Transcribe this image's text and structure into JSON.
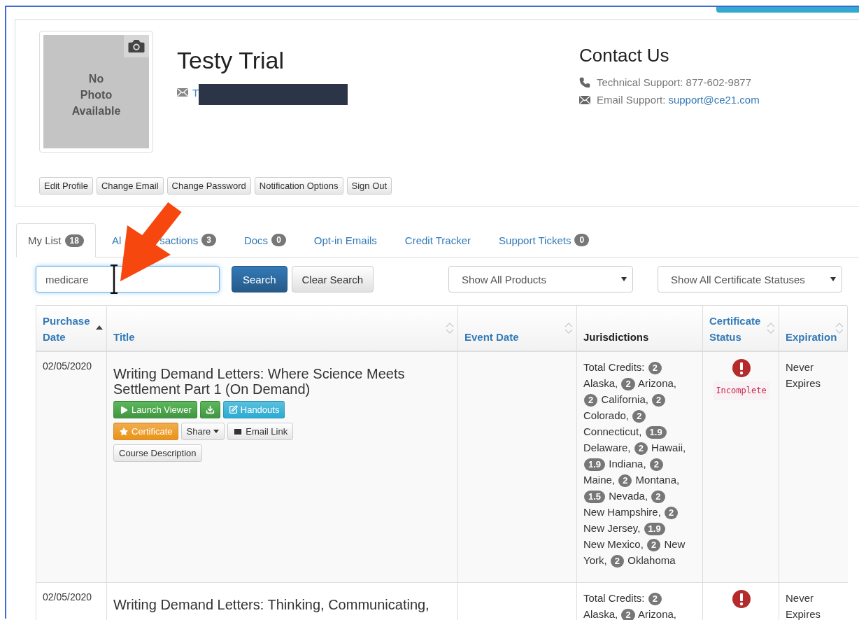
{
  "profile": {
    "photo_lines": [
      "No",
      "Photo",
      "Available"
    ],
    "name": "Testy Trial",
    "email": "T",
    "buttons": [
      "Edit Profile",
      "Change Email",
      "Change Password",
      "Notification Options",
      "Sign Out"
    ]
  },
  "contact": {
    "title": "Contact Us",
    "phone": "Technical Support: 877-602-9877",
    "email_label": "Email Support:",
    "email": "support@ce21.com"
  },
  "tabs": [
    {
      "label_parts": [
        "My List"
      ],
      "count": "18",
      "selected": true
    },
    {
      "label_parts": [
        "Al",
        "sactions"
      ],
      "count": "3",
      "selected": false
    },
    {
      "label_parts": [
        "Docs"
      ],
      "count": "0",
      "selected": false
    },
    {
      "label_parts": [
        "Opt-in Emails"
      ],
      "selected": false
    },
    {
      "label_parts": [
        "Credit Tracker"
      ],
      "selected": false
    },
    {
      "label_parts": [
        "Support Tickets"
      ],
      "count": "0",
      "selected": false
    }
  ],
  "search": {
    "value": "medicare",
    "search_button": "Search",
    "clear_button": "Clear Search"
  },
  "filters": [
    "Show All Products",
    "Show All Certificate Statuses"
  ],
  "table": {
    "columns": [
      {
        "label": "Purchase Date",
        "sortable": true,
        "sorted": true,
        "link": true
      },
      {
        "label": "Title",
        "sortable": true,
        "sorted": false,
        "link": true
      },
      {
        "label": "Event Date",
        "sortable": true,
        "sorted": false,
        "link": true
      },
      {
        "label": "Jurisdictions",
        "sortable": false,
        "link": false
      },
      {
        "label": "Certificate Status",
        "sortable": true,
        "sorted": false,
        "link": true
      },
      {
        "label": "Expiration",
        "sortable": true,
        "sorted": false,
        "link": true
      }
    ],
    "rows": [
      {
        "date": "02/05/2020",
        "title": "Writing Demand Letters: Where Science Meets Settlement Part 1 (On Demand)",
        "actions": [
          [
            {
              "kind": "launch",
              "label": "Launch Viewer"
            },
            {
              "kind": "download"
            },
            {
              "kind": "handouts",
              "label": "Handouts"
            }
          ],
          [
            {
              "kind": "certificate",
              "label": "Certificate"
            },
            {
              "kind": "share",
              "label": "Share"
            },
            {
              "kind": "email",
              "label": "Email Link"
            }
          ],
          [
            {
              "kind": "plain",
              "label": "Course Description"
            }
          ]
        ],
        "jurisdictions": [
          {
            "kind": "text",
            "text": "Total Credits:"
          },
          {
            "kind": "badge",
            "text": "2"
          },
          {
            "kind": "text",
            "text": "Alaska,"
          },
          {
            "kind": "badge",
            "text": "2"
          },
          {
            "kind": "text",
            "text": "Arizona,"
          },
          {
            "kind": "badge",
            "text": "2"
          },
          {
            "kind": "text",
            "text": "California,"
          },
          {
            "kind": "badge",
            "text": "2"
          },
          {
            "kind": "text",
            "text": "Colorado,"
          },
          {
            "kind": "badge",
            "text": "2"
          },
          {
            "kind": "text",
            "text": "Connecticut,"
          },
          {
            "kind": "badge",
            "text": "1.9"
          },
          {
            "kind": "text",
            "text": "Delaware,"
          },
          {
            "kind": "badge",
            "text": "2"
          },
          {
            "kind": "text",
            "text": "Hawaii,"
          },
          {
            "kind": "badge",
            "text": "1.9"
          },
          {
            "kind": "text",
            "text": "Indiana,"
          },
          {
            "kind": "badge",
            "text": "2"
          },
          {
            "kind": "text",
            "text": "Maine,"
          },
          {
            "kind": "badge",
            "text": "2"
          },
          {
            "kind": "text",
            "text": "Montana,"
          },
          {
            "kind": "badge",
            "text": "1.5"
          },
          {
            "kind": "text",
            "text": "Nevada,"
          },
          {
            "kind": "badge",
            "text": "2"
          },
          {
            "kind": "text",
            "text": "New Hampshire,"
          },
          {
            "kind": "badge",
            "text": "2"
          },
          {
            "kind": "text",
            "text": "New Jersey,"
          },
          {
            "kind": "badge",
            "text": "1.9"
          },
          {
            "kind": "text",
            "text": "New Mexico,"
          },
          {
            "kind": "badge",
            "text": "2"
          },
          {
            "kind": "text",
            "text": "New"
          },
          {
            "kind": "text",
            "text": "York,"
          },
          {
            "kind": "badge",
            "text": "2"
          },
          {
            "kind": "text",
            "text": "Oklahoma"
          }
        ],
        "alert": true,
        "status": "Incomplete",
        "expiration": "Never Expires"
      },
      {
        "date": "02/05/2020",
        "title": "Writing Demand Letters: Thinking, Communicating,",
        "jurisdictions": [
          {
            "kind": "text",
            "text": "Total Credits:"
          },
          {
            "kind": "badge",
            "text": "2"
          },
          {
            "kind": "text",
            "text": "Alaska,"
          },
          {
            "kind": "badge",
            "text": "2"
          },
          {
            "kind": "text",
            "text": "Arizona,"
          }
        ],
        "alert": true,
        "expiration": "Never Expires"
      }
    ]
  }
}
